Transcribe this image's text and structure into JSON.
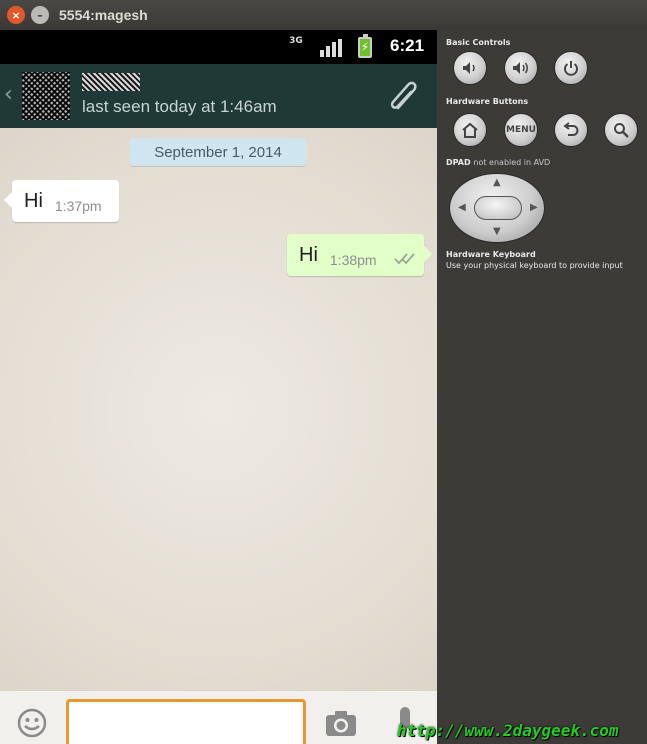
{
  "window": {
    "title": "5554:magesh"
  },
  "statusbar": {
    "network": "3G",
    "time": "6:21"
  },
  "chat_header": {
    "last_seen": "last seen today at 1:46am"
  },
  "chat": {
    "date": "September 1, 2014",
    "messages": [
      {
        "direction": "incoming",
        "text": "Hi",
        "time": "1:37pm"
      },
      {
        "direction": "outgoing",
        "text": "Hi",
        "time": "1:38pm"
      }
    ]
  },
  "input": {
    "value": "",
    "placeholder": ""
  },
  "controls": {
    "basic_label": "Basic Controls",
    "hardware_label": "Hardware Buttons",
    "menu_label": "MENU",
    "dpad_label": "DPAD",
    "dpad_note": "not enabled in AVD",
    "keyboard_title": "Hardware Keyboard",
    "keyboard_note": "Use your physical keyboard to provide input"
  },
  "watermark": "http://www.2daygeek.com",
  "colors": {
    "appbar": "#1f3a36",
    "outgoing_bubble": "#e1ffc7",
    "date_pill": "#cfe6f0",
    "input_border": "#f0962e",
    "watermark": "#22cc22"
  }
}
